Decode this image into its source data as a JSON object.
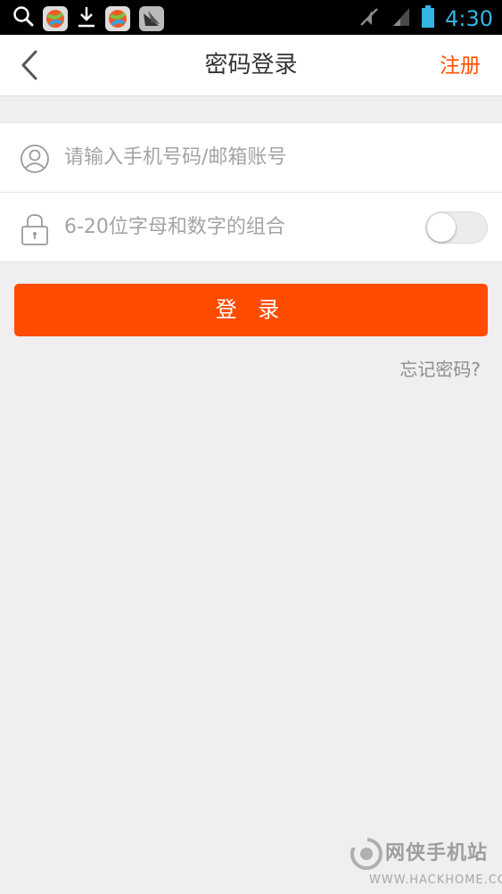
{
  "status_bar": {
    "time": "4:30",
    "left_icons": [
      "search-icon",
      "app-icon",
      "download-icon",
      "app-icon",
      "image-icon"
    ],
    "right_icons": [
      "silent-icon",
      "signal-icon",
      "battery-icon"
    ]
  },
  "header": {
    "title": "密码登录",
    "register_label": "注册",
    "back_icon": "chevron-left-icon"
  },
  "form": {
    "account": {
      "placeholder": "请输入手机号码/邮箱账号",
      "value": "",
      "icon": "user-icon"
    },
    "password": {
      "placeholder": "6-20位字母和数字的组合",
      "value": "",
      "icon": "lock-icon",
      "show_password": false
    }
  },
  "login_button_label": "登 录",
  "forgot_password_label": "忘记密码?",
  "watermark": {
    "title": "网侠手机站",
    "url": "WWW.HACKHOME.COM"
  },
  "colors": {
    "accent": "#ff4c00",
    "register": "#ff5100",
    "background": "#f0eeee",
    "status_time": "#34b5e5"
  }
}
